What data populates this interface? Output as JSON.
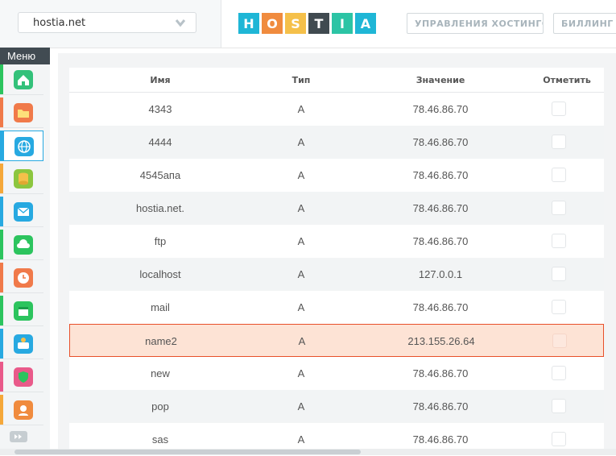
{
  "header": {
    "domain_select": {
      "value": "hostia.net"
    },
    "logo_letters": [
      {
        "ch": "H",
        "color": "#1fb6d6"
      },
      {
        "ch": "O",
        "color": "#f08b3e"
      },
      {
        "ch": "S",
        "color": "#f5c04a"
      },
      {
        "ch": "T",
        "color": "#404a50"
      },
      {
        "ch": "I",
        "color": "#2cc4a5"
      },
      {
        "ch": "A",
        "color": "#1fb6d6"
      }
    ],
    "nav": [
      {
        "label": "УПРАВЛЕНИЯ ХОСТИНГОМ"
      },
      {
        "label": "БИЛЛИНГ П"
      }
    ]
  },
  "sidebar": {
    "menu_label": "Меню",
    "items": [
      {
        "icon": "home-icon",
        "stripe": "#2cc45e",
        "bg": "#33c17a"
      },
      {
        "icon": "folder-icon",
        "stripe": "#f07a4a",
        "bg": "#f07a4a"
      },
      {
        "icon": "www-globe-icon",
        "stripe": "#27a9e1",
        "bg": "#27a9e1",
        "active": true
      },
      {
        "icon": "database-icon",
        "stripe": "#f5a83a",
        "bg": "#8cc63f"
      },
      {
        "icon": "mail-icon",
        "stripe": "#27a9e1",
        "bg": "#27a9e1"
      },
      {
        "icon": "ftp-cloud-icon",
        "stripe": "#2cc45e",
        "bg": "#2cc45e"
      },
      {
        "icon": "clock-icon",
        "stripe": "#f07a4a",
        "bg": "#f07a4a"
      },
      {
        "icon": "calendar-icon",
        "stripe": "#2cc45e",
        "bg": "#2cc45e"
      },
      {
        "icon": "php-icon",
        "stripe": "#27a9e1",
        "bg": "#27a9e1"
      },
      {
        "icon": "shield-icon",
        "stripe": "#e95a8a",
        "bg": "#e95a8a"
      },
      {
        "icon": "support-user-icon",
        "stripe": "#f5a83a",
        "bg": "#f08b3e"
      }
    ]
  },
  "table": {
    "headers": {
      "name": "Имя",
      "type": "Тип",
      "value": "Значение",
      "mark": "Отметить"
    },
    "rows": [
      {
        "name": "4343",
        "type": "A",
        "value": "78.46.86.70"
      },
      {
        "name": "4444",
        "type": "A",
        "value": "78.46.86.70"
      },
      {
        "name": "4545апа",
        "type": "A",
        "value": "78.46.86.70"
      },
      {
        "name": "hostia.net.",
        "type": "A",
        "value": "78.46.86.70"
      },
      {
        "name": "ftp",
        "type": "A",
        "value": "78.46.86.70"
      },
      {
        "name": "localhost",
        "type": "A",
        "value": "127.0.0.1"
      },
      {
        "name": "mail",
        "type": "A",
        "value": "78.46.86.70"
      },
      {
        "name": "name2",
        "type": "A",
        "value": "213.155.26.64",
        "highlighted": true
      },
      {
        "name": "new",
        "type": "A",
        "value": "78.46.86.70"
      },
      {
        "name": "pop",
        "type": "A",
        "value": "78.46.86.70"
      },
      {
        "name": "sas",
        "type": "A",
        "value": "78.46.86.70"
      }
    ]
  }
}
